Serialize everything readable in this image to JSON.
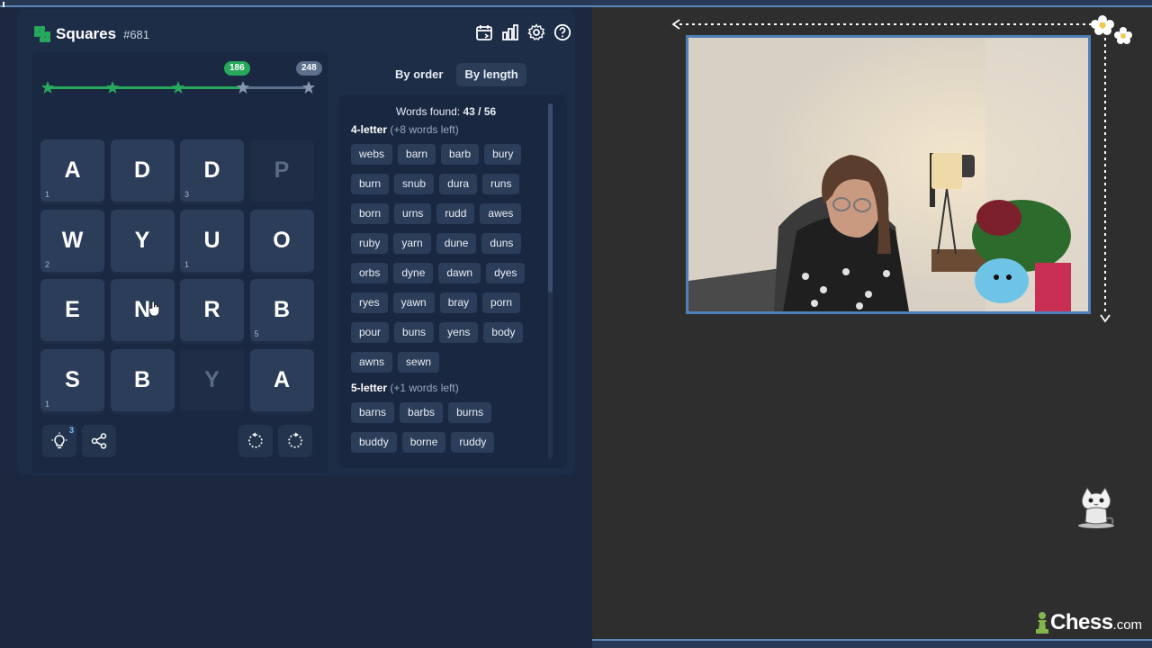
{
  "game": {
    "name": "Squares",
    "puzzle_number": "#681",
    "progress": {
      "current_badge": "186",
      "max_badge": "248",
      "reached_fraction": 0.75
    },
    "tiles": [
      {
        "letter": "A",
        "num": "1",
        "dim": false
      },
      {
        "letter": "D",
        "num": "",
        "dim": false
      },
      {
        "letter": "D",
        "num": "3",
        "dim": false
      },
      {
        "letter": "P",
        "num": "",
        "dim": true
      },
      {
        "letter": "W",
        "num": "2",
        "dim": false
      },
      {
        "letter": "Y",
        "num": "",
        "dim": false
      },
      {
        "letter": "U",
        "num": "1",
        "dim": false
      },
      {
        "letter": "O",
        "num": "",
        "dim": false
      },
      {
        "letter": "E",
        "num": "",
        "dim": false
      },
      {
        "letter": "N",
        "num": "",
        "dim": false
      },
      {
        "letter": "R",
        "num": "",
        "dim": false
      },
      {
        "letter": "B",
        "num": "5",
        "dim": false
      },
      {
        "letter": "S",
        "num": "1",
        "dim": false
      },
      {
        "letter": "B",
        "num": "",
        "dim": false
      },
      {
        "letter": "Y",
        "num": "",
        "dim": true
      },
      {
        "letter": "A",
        "num": "",
        "dim": false
      }
    ],
    "hint_count": "3"
  },
  "tabs": {
    "by_order": "By order",
    "by_length": "By length",
    "active": "by_length"
  },
  "words": {
    "found_label": "Words found:",
    "found_value": "43 / 56",
    "sections": [
      {
        "title": "4-letter",
        "left": "(+8 words left)",
        "words": [
          "webs",
          "barn",
          "barb",
          "bury",
          "burn",
          "snub",
          "dura",
          "runs",
          "born",
          "urns",
          "rudd",
          "awes",
          "ruby",
          "yarn",
          "dune",
          "duns",
          "orbs",
          "dyne",
          "dawn",
          "dyes",
          "ryes",
          "yawn",
          "bray",
          "porn",
          "pour",
          "buns",
          "yens",
          "body",
          "awns",
          "sewn"
        ]
      },
      {
        "title": "5-letter",
        "left": "(+1 words left)",
        "words": [
          "barns",
          "barbs",
          "burns",
          "buddy",
          "borne",
          "ruddy"
        ]
      }
    ]
  },
  "brand": {
    "main": "Chess",
    "suffix": ".com"
  },
  "colors": {
    "accent_green": "#27a85a",
    "panel_bg": "#1b2840",
    "tile_bg": "#2c3d5a",
    "frame_blue": "#4f7fb8"
  }
}
